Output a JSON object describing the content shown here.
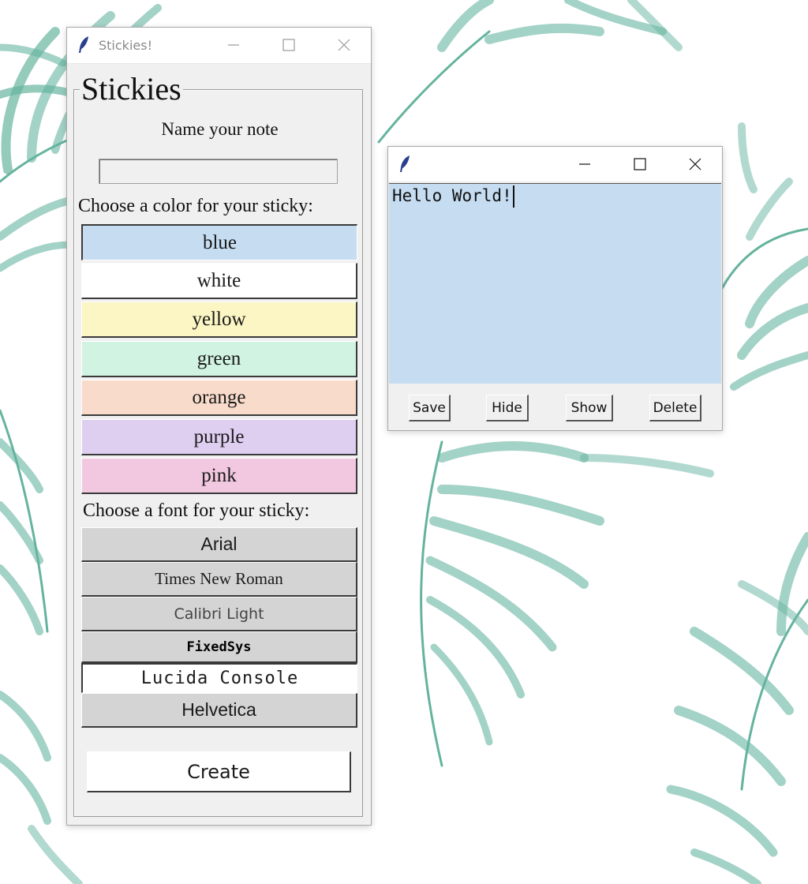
{
  "main_window": {
    "title": "Stickies!",
    "icon": "tk-feather-icon",
    "frame_title": "Stickies",
    "name_label": "Name your note",
    "name_value": "",
    "color_label": "Choose a color for your sticky:",
    "colors": [
      {
        "label": "blue",
        "color": "#c5dcf1"
      },
      {
        "label": "white",
        "color": "#ffffff"
      },
      {
        "label": "yellow",
        "color": "#fbf6c3"
      },
      {
        "label": "green",
        "color": "#d1f3e1"
      },
      {
        "label": "orange",
        "color": "#f8dbcb"
      },
      {
        "label": "purple",
        "color": "#decef0"
      },
      {
        "label": "pink",
        "color": "#f2c7e0"
      }
    ],
    "font_label": "Choose a font for your sticky:",
    "fonts": [
      {
        "label": "Arial"
      },
      {
        "label": "Times New Roman"
      },
      {
        "label": "Calibri Light"
      },
      {
        "label": "FixedSys"
      },
      {
        "label": "Lucida Console"
      },
      {
        "label": "Helvetica"
      }
    ],
    "create_label": "Create"
  },
  "note_window": {
    "title": "",
    "icon": "tk-feather-icon",
    "background": "#c5dcf1",
    "text": "Hello World!",
    "buttons": [
      "Save",
      "Hide",
      "Show",
      "Delete"
    ]
  },
  "colors": {
    "leaf": "#3f9e85",
    "window_bg": "#f0f0f0"
  }
}
